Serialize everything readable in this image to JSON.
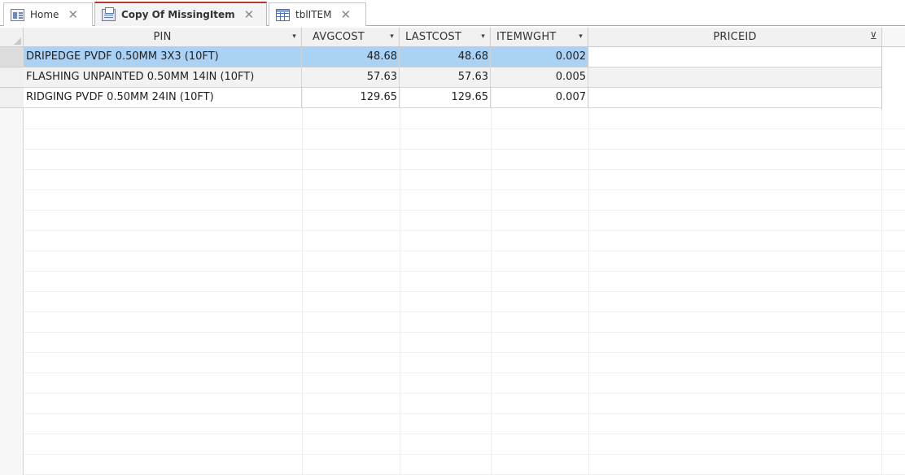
{
  "tabs": [
    {
      "label": "Home",
      "icon": "form-icon",
      "active": false
    },
    {
      "label": "Copy Of MissingItem",
      "icon": "query-icon",
      "active": true
    },
    {
      "label": "tblITEM",
      "icon": "table-icon",
      "active": false
    }
  ],
  "close_glyph": "✕",
  "columns": [
    {
      "name": "PIN",
      "indicator": "▾"
    },
    {
      "name": "AVGCOST",
      "indicator": "▾"
    },
    {
      "name": "LASTCOST",
      "indicator": "▾"
    },
    {
      "name": "ITEMWGHT",
      "indicator": "▾"
    },
    {
      "name": "PRICEID",
      "indicator": "⊻"
    }
  ],
  "rows": [
    {
      "PIN": "DRIPEDGE PVDF 0.50MM 3X3 (10FT)",
      "AVGCOST": "48.68",
      "LASTCOST": "48.68",
      "ITEMWGHT": "0.002",
      "PRICEID": ""
    },
    {
      "PIN": "FLASHING UNPAINTED 0.50MM 14IN (10FT)",
      "AVGCOST": "57.63",
      "LASTCOST": "57.63",
      "ITEMWGHT": "0.005",
      "PRICEID": ""
    },
    {
      "PIN": "RIDGING PVDF 0.50MM 24IN (10FT)",
      "AVGCOST": "129.65",
      "LASTCOST": "129.65",
      "ITEMWGHT": "0.007",
      "PRICEID": ""
    }
  ],
  "colors": {
    "selection": "#a9d2f5",
    "active_tab_accent": "#b9352e"
  }
}
